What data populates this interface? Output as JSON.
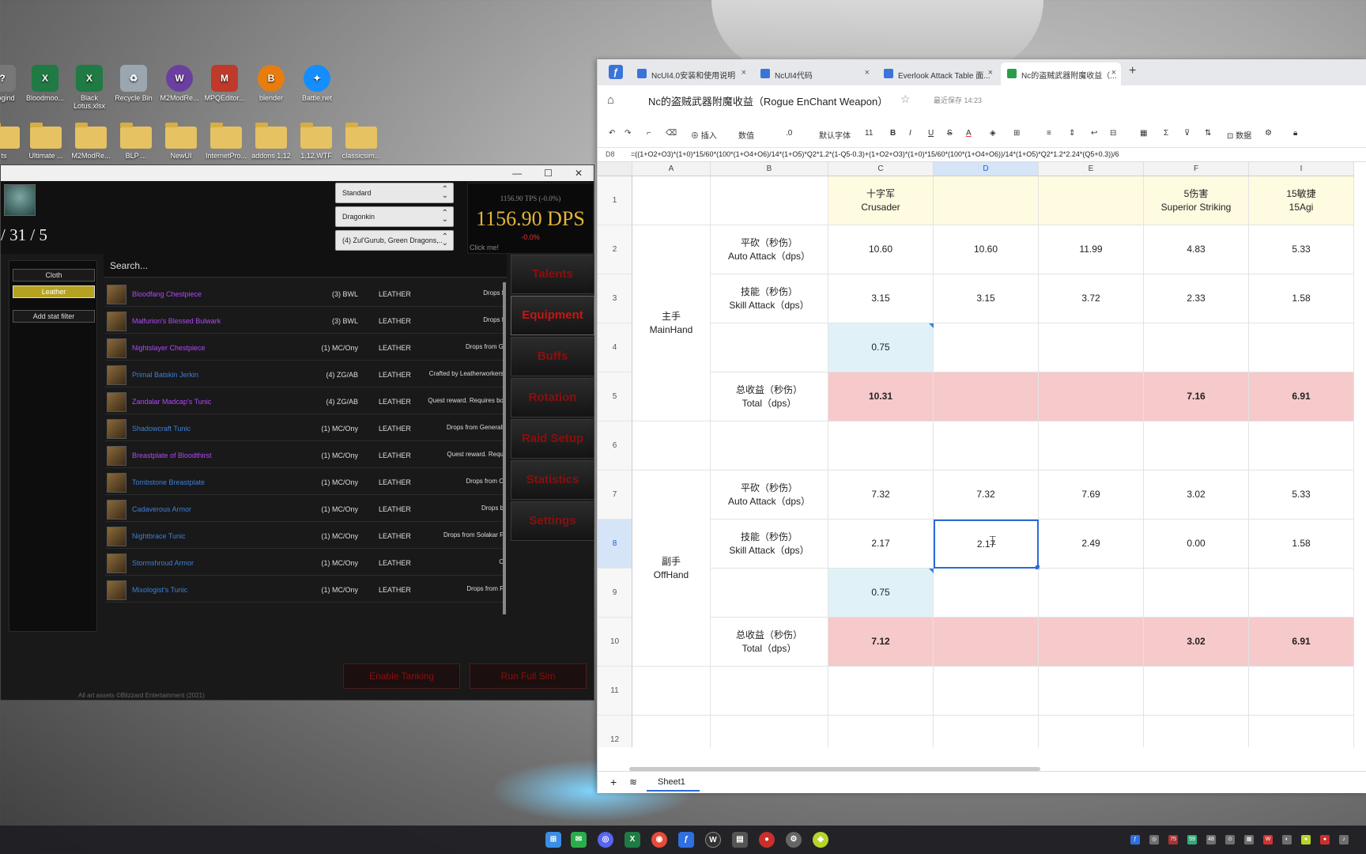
{
  "desktop": {
    "icons": [
      "ullogind",
      "Bloodmoo...",
      "Black Lotus.xlsx",
      "Recycle Bin",
      "M2ModRe...",
      "MPQEditor...",
      "blender",
      "Battle.net"
    ],
    "folders": [
      "ts",
      "Ultimate ...",
      "M2ModRe...",
      "BLP ...",
      "NewUI",
      "InternetPro...",
      "addons 1.12",
      "1.12.WTF",
      "classicsim..."
    ]
  },
  "sim": {
    "talents": "/ 31 / 5",
    "selects": [
      "Standard",
      "Dragonkin",
      "(4) Zul'Gurub, Green Dragons,.."
    ],
    "tps": "1156.90 TPS (-0.0%)",
    "dps": "1156.90 DPS",
    "delta": "-0.0%",
    "click_me": "Click me!",
    "filters": {
      "cloth": "Cloth",
      "leather": "Leather",
      "add_stat": "Add stat filter"
    },
    "search_placeholder": "Search...",
    "items": [
      {
        "name": "Bloodfang Chestpiece",
        "source": "(3) BWL",
        "type": "LEATHER",
        "drop": "Drops f",
        "quality": "epic"
      },
      {
        "name": "Malfurion's Blessed Bulwark",
        "source": "(3) BWL",
        "type": "LEATHER",
        "drop": "Drops f",
        "quality": "epic"
      },
      {
        "name": "Nightslayer Chestpiece",
        "source": "(1) MC/Ony",
        "type": "LEATHER",
        "drop": "Drops from G",
        "quality": "epic"
      },
      {
        "name": "Primal Batskin Jerkin",
        "source": "(4) ZG/AB",
        "type": "LEATHER",
        "drop": "Crafted by Leatherworkers",
        "quality": "rare"
      },
      {
        "name": "Zandalar Madcap's Tunic",
        "source": "(4) ZG/AB",
        "type": "LEATHER",
        "drop": "Quest reward. Requires bo",
        "quality": "epic"
      },
      {
        "name": "Shadowcraft Tunic",
        "source": "(1) MC/Ony",
        "type": "LEATHER",
        "drop": "Drops from Generall",
        "quality": "rare"
      },
      {
        "name": "Breastplate of Bloodthirst",
        "source": "(1) MC/Ony",
        "type": "LEATHER",
        "drop": "Quest reward. Requ",
        "quality": "epic"
      },
      {
        "name": "Tombstone Breastplate",
        "source": "(1) MC/Ony",
        "type": "LEATHER",
        "drop": "Drops from C",
        "quality": "rare"
      },
      {
        "name": "Cadaverous Armor",
        "source": "(1) MC/Ony",
        "type": "LEATHER",
        "drop": "Drops b",
        "quality": "rare"
      },
      {
        "name": "Nightbrace Tunic",
        "source": "(1) MC/Ony",
        "type": "LEATHER",
        "drop": "Drops from Solakar F",
        "quality": "rare"
      },
      {
        "name": "Stormshroud Armor",
        "source": "(1) MC/Ony",
        "type": "LEATHER",
        "drop": "C",
        "quality": "rare"
      },
      {
        "name": "Mixologist's Tunic",
        "source": "(1) MC/Ony",
        "type": "LEATHER",
        "drop": "Drops from F",
        "quality": "rare"
      }
    ],
    "nav": [
      "Talents",
      "Equipment",
      "Buffs",
      "Rotation",
      "Raid Setup",
      "Statistics",
      "Settings"
    ],
    "enable_tanking": "Enable Tanking",
    "run_full_sim": "Run Full Sim",
    "footer": "All art assets ©Blizzard Entertainment (2021)"
  },
  "browser": {
    "tabs": [
      {
        "title": "NcUI4.0安装和使用说明",
        "color": "#3b74d9"
      },
      {
        "title": "NcUI4代码",
        "color": "#3b74d9"
      },
      {
        "title": "Everlook Attack Table 面...",
        "color": "#3b74d9"
      },
      {
        "title": "Nc的盗贼武器附魔收益（...",
        "color": "#2a9d4a"
      }
    ],
    "doc_title": "Nc的盗贼武器附魔收益（Rogue EnChant Weapon）",
    "save_status": "最近保存 14:23",
    "toolbar": {
      "insert": "插入",
      "number": "数值",
      "decimal": ".0",
      "font": "默认字体",
      "size": "11",
      "data": "数据"
    },
    "cell_ref": "D8",
    "formula": "=((1+O2+O3)*(1+0)*15/60*(100*(1+O4+O6)/14*(1+O5)*Q2*1.2*(1-Q5-0.3)+(1+O2+O3)*(1+0)*15/60*(100*(1+O4+O6))/14*(1+O5)*Q2*1.2*2.24*(Q5+0.3))/6",
    "columns": [
      "A",
      "B",
      "C",
      "D",
      "E",
      "F",
      "I"
    ],
    "rows": [
      "1",
      "2",
      "3",
      "4",
      "5",
      "6",
      "7",
      "8",
      "9",
      "10",
      "11",
      "12"
    ],
    "sheet_tab": "Sheet1"
  },
  "sheet": {
    "header": {
      "crusader": [
        "十字军",
        "Crusader"
      ],
      "striking": [
        "5伤害",
        "Superior Striking"
      ],
      "agi": [
        "15敏捷",
        "15Agi"
      ]
    },
    "mainhand": [
      "主手",
      "MainHand"
    ],
    "offhand": [
      "副手",
      "OffHand"
    ],
    "auto_attack": [
      "平砍（秒伤）",
      "Auto Attack（dps）"
    ],
    "skill_attack": [
      "技能（秒伤）",
      "Skill Attack（dps）"
    ],
    "total": [
      "总收益（秒伤）",
      "Total（dps）"
    ],
    "r2": [
      "10.60",
      "10.60",
      "11.99",
      "4.83",
      "5.33"
    ],
    "r3": [
      "3.15",
      "3.15",
      "3.72",
      "2.33",
      "1.58"
    ],
    "r4": "0.75",
    "r5": [
      "10.31",
      "7.16",
      "6.91"
    ],
    "r7": [
      "7.32",
      "7.32",
      "7.69",
      "3.02",
      "5.33"
    ],
    "r8": [
      "2.17",
      "2.17",
      "2.49",
      "0.00",
      "1.58"
    ],
    "r9": "0.75",
    "r10": [
      "7.12",
      "3.02",
      "6.91"
    ]
  }
}
